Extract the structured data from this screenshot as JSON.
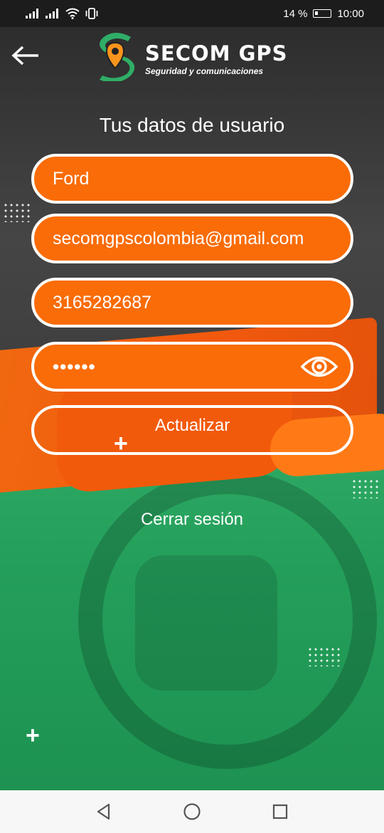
{
  "status_bar": {
    "battery_percent": "14 %",
    "time": "10:00"
  },
  "header": {
    "brand_title": "SECOM GPS",
    "brand_subtitle": "Seguridad y comunicaciones",
    "back_icon": "arrow-left-icon"
  },
  "page": {
    "title": "Tus datos de usuario"
  },
  "form": {
    "name_value": "Ford",
    "email_value": "secomgpscolombia@gmail.com",
    "phone_value": "3165282687",
    "password_masked": "••••••",
    "password_toggle_icon": "eye-icon",
    "update_label": "Actualizar"
  },
  "footer": {
    "logout_label": "Cerrar sesión"
  },
  "colors": {
    "accent_orange": "#f96c07",
    "accent_green": "#2fae67",
    "logo_green": "#2fae67",
    "logo_orange": "#f7941d"
  }
}
